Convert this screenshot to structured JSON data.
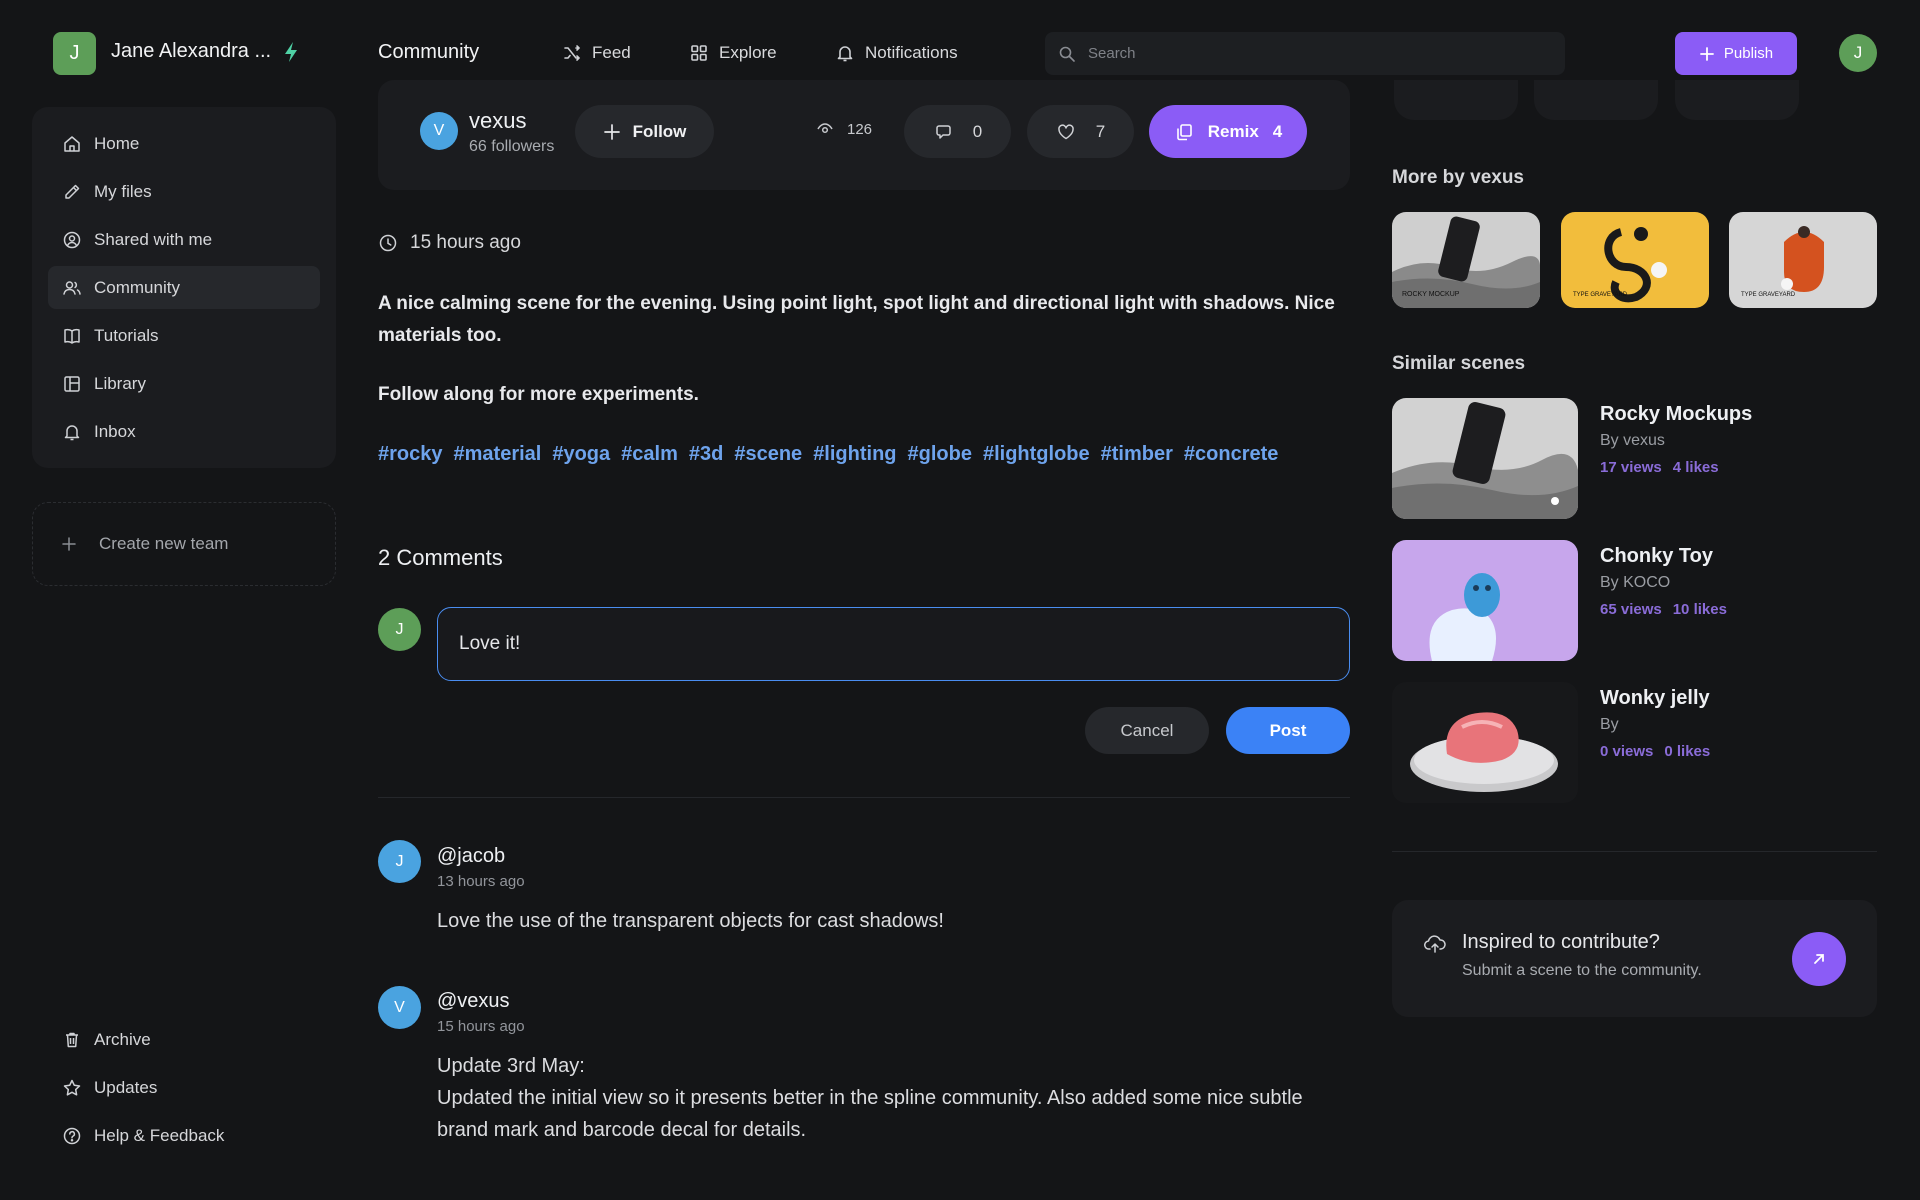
{
  "workspace": {
    "avatar_letter": "J",
    "name": "Jane Alexandra ...",
    "icon": "bolt-icon"
  },
  "header": {
    "title": "Community",
    "nav": [
      {
        "label": "Feed",
        "icon": "shuffle-icon"
      },
      {
        "label": "Explore",
        "icon": "grid-icon"
      },
      {
        "label": "Notifications",
        "icon": "bell-icon"
      }
    ],
    "search_placeholder": "Search",
    "publish_label": "Publish",
    "user_avatar_letter": "J"
  },
  "sidebar": {
    "items": [
      {
        "label": "Home",
        "icon": "home-icon"
      },
      {
        "label": "My files",
        "icon": "pencil-icon"
      },
      {
        "label": "Shared with me",
        "icon": "user-circle-icon"
      },
      {
        "label": "Community",
        "icon": "users-icon",
        "active": true
      },
      {
        "label": "Tutorials",
        "icon": "book-icon"
      },
      {
        "label": "Library",
        "icon": "library-icon"
      },
      {
        "label": "Inbox",
        "icon": "bell-icon"
      }
    ],
    "new_team_label": "Create new team",
    "bottom_items": [
      {
        "label": "Archive",
        "icon": "trash-icon"
      },
      {
        "label": "Updates",
        "icon": "star-icon"
      },
      {
        "label": "Help & Feedback",
        "icon": "help-icon"
      }
    ]
  },
  "post": {
    "author": {
      "avatar_letter": "V",
      "name": "vexus",
      "followers": "66 followers"
    },
    "follow_label": "Follow",
    "views": "126",
    "comments_count": "0",
    "likes": "7",
    "remix_label": "Remix",
    "remix_count": "4",
    "time": "15 hours ago",
    "description": "A nice calming scene for the evening. Using point light, spot light and directional light with shadows. Nice materials too.",
    "description2": "Follow along for more experiments.",
    "tags": [
      "#rocky",
      "#material",
      "#yoga",
      "#calm",
      "#3d",
      "#scene",
      "#lighting",
      "#globe",
      "#lightglobe",
      "#timber",
      "#concrete"
    ]
  },
  "comments": {
    "title": "2 Comments",
    "me_avatar_letter": "J",
    "draft": "Love it!",
    "cancel_label": "Cancel",
    "post_label": "Post",
    "list": [
      {
        "avatar_letter": "J",
        "user": "@jacob",
        "time": "13 hours ago",
        "text": "Love the use of the transparent objects for cast shadows!"
      },
      {
        "avatar_letter": "V",
        "user": "@vexus",
        "time": "15 hours ago",
        "text": "Update 3rd May:\nUpdated the initial view so it presents better in the spline community. Also added some nice subtle brand mark and barcode decal for details."
      }
    ]
  },
  "right": {
    "more_by_title": "More by vexus",
    "more_by": [
      {
        "name": "rocky-mockup-thumbnail",
        "caption": "ROCKY MOCKUP"
      },
      {
        "name": "type-graveyard-yellow-thumbnail",
        "caption": "TYPE GRAVEYARD"
      },
      {
        "name": "type-graveyard-grey-thumbnail",
        "caption": "TYPE GRAVEYARD"
      }
    ],
    "similar_title": "Similar scenes",
    "similar": [
      {
        "title": "Rocky Mockups",
        "by": "By vexus",
        "views": "17 views",
        "likes": "4 likes"
      },
      {
        "title": "Chonky Toy",
        "by": "By KOCO",
        "views": "65 views",
        "likes": "10 likes"
      },
      {
        "title": "Wonky jelly",
        "by": "By",
        "views": "0 views",
        "likes": "0 likes"
      }
    ],
    "inspire_title": "Inspired to contribute?",
    "inspire_sub": "Submit a scene to the community.",
    "colors": {
      "accent": "#8b5cf6",
      "link": "#6ea3ec",
      "primary": "#3b82f6"
    }
  }
}
